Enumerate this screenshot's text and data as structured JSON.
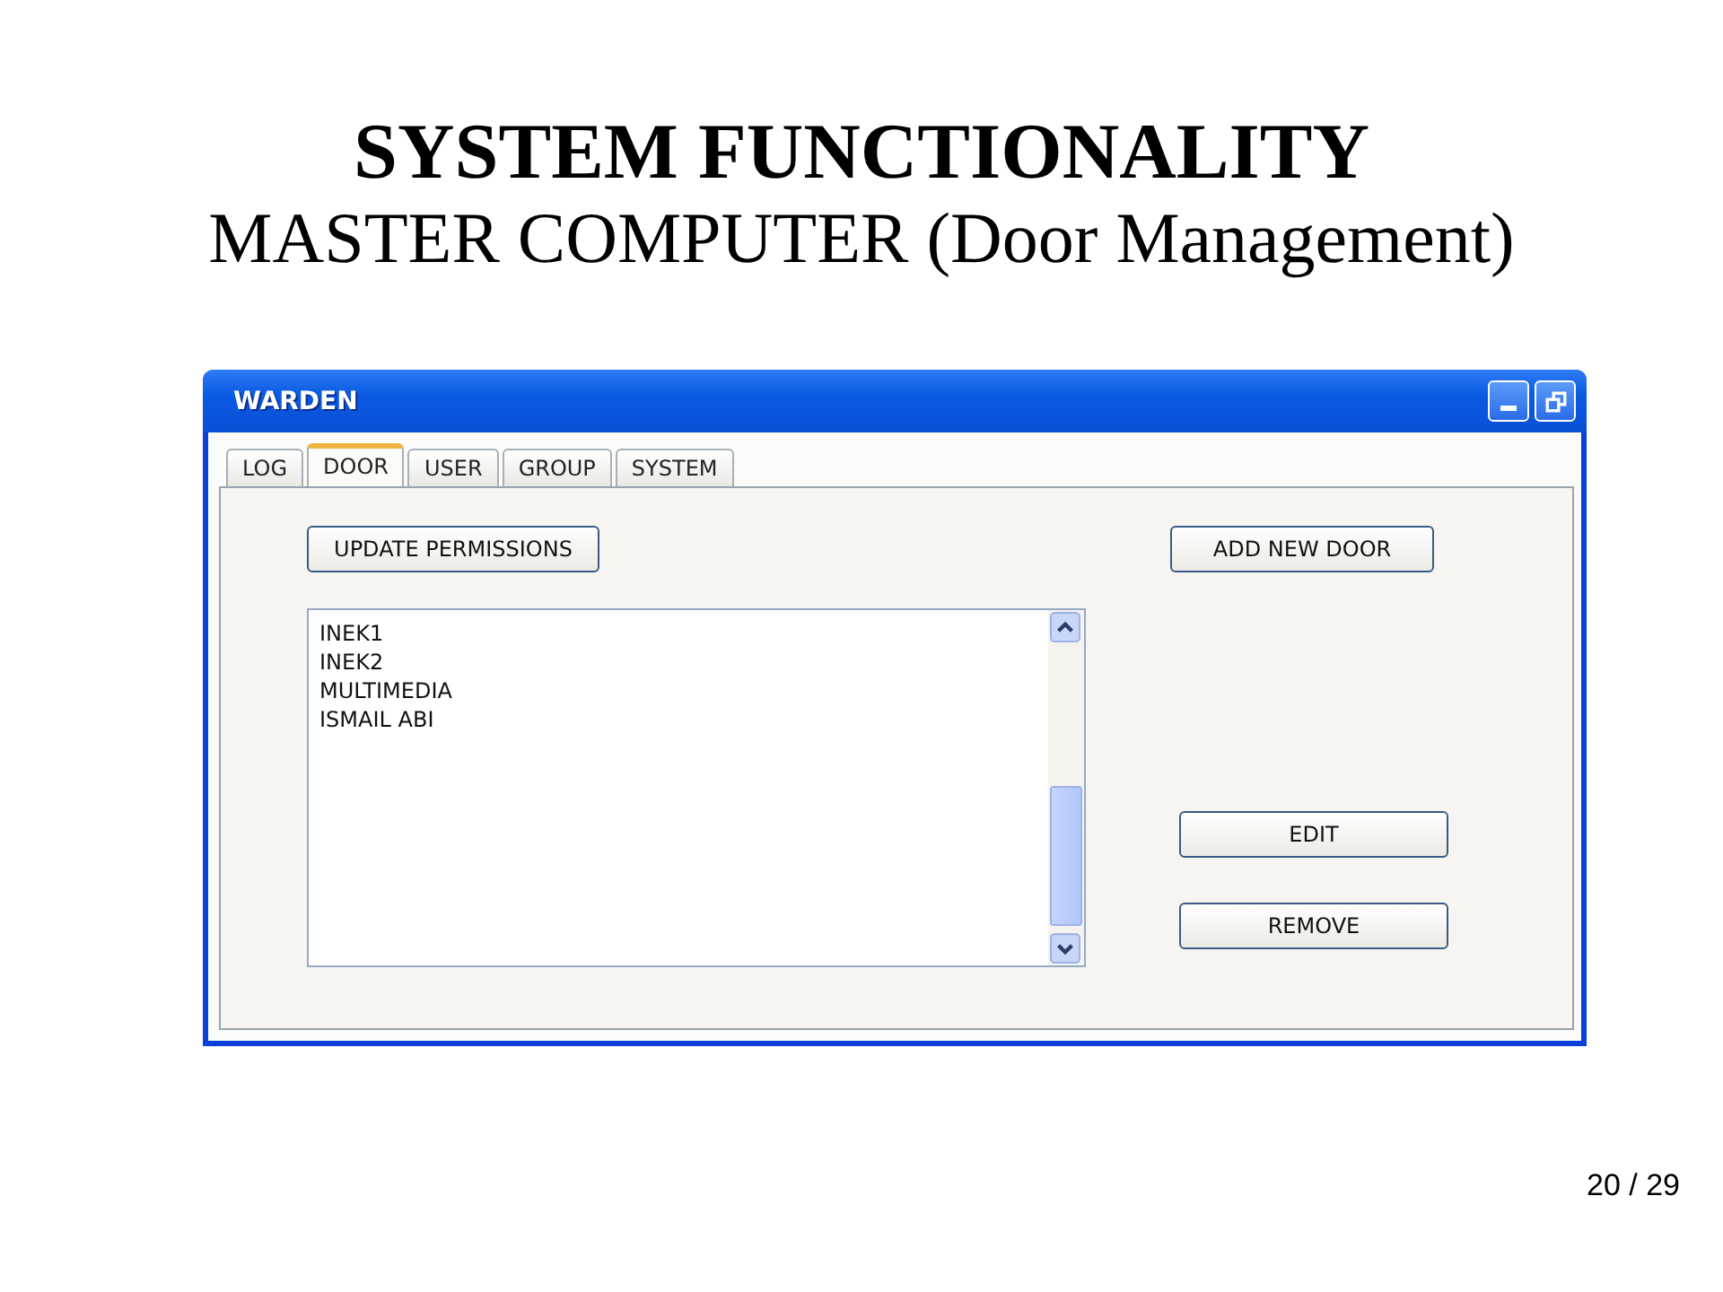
{
  "slide": {
    "title": "SYSTEM FUNCTIONALITY",
    "subtitle": "MASTER COMPUTER (Door Management)",
    "page_number": "20 / 29"
  },
  "window": {
    "title": "WARDEN"
  },
  "tabs": [
    {
      "label": "LOG",
      "selected": false
    },
    {
      "label": "DOOR",
      "selected": true
    },
    {
      "label": "USER",
      "selected": false
    },
    {
      "label": "GROUP",
      "selected": false
    },
    {
      "label": "SYSTEM",
      "selected": false
    }
  ],
  "panel": {
    "update_button": "UPDATE PERMISSIONS",
    "add_button": "ADD NEW DOOR",
    "edit_button": "EDIT",
    "remove_button": "REMOVE",
    "doors": [
      "INEK1",
      "INEK2",
      "MULTIMEDIA",
      "ISMAIL ABI"
    ]
  }
}
